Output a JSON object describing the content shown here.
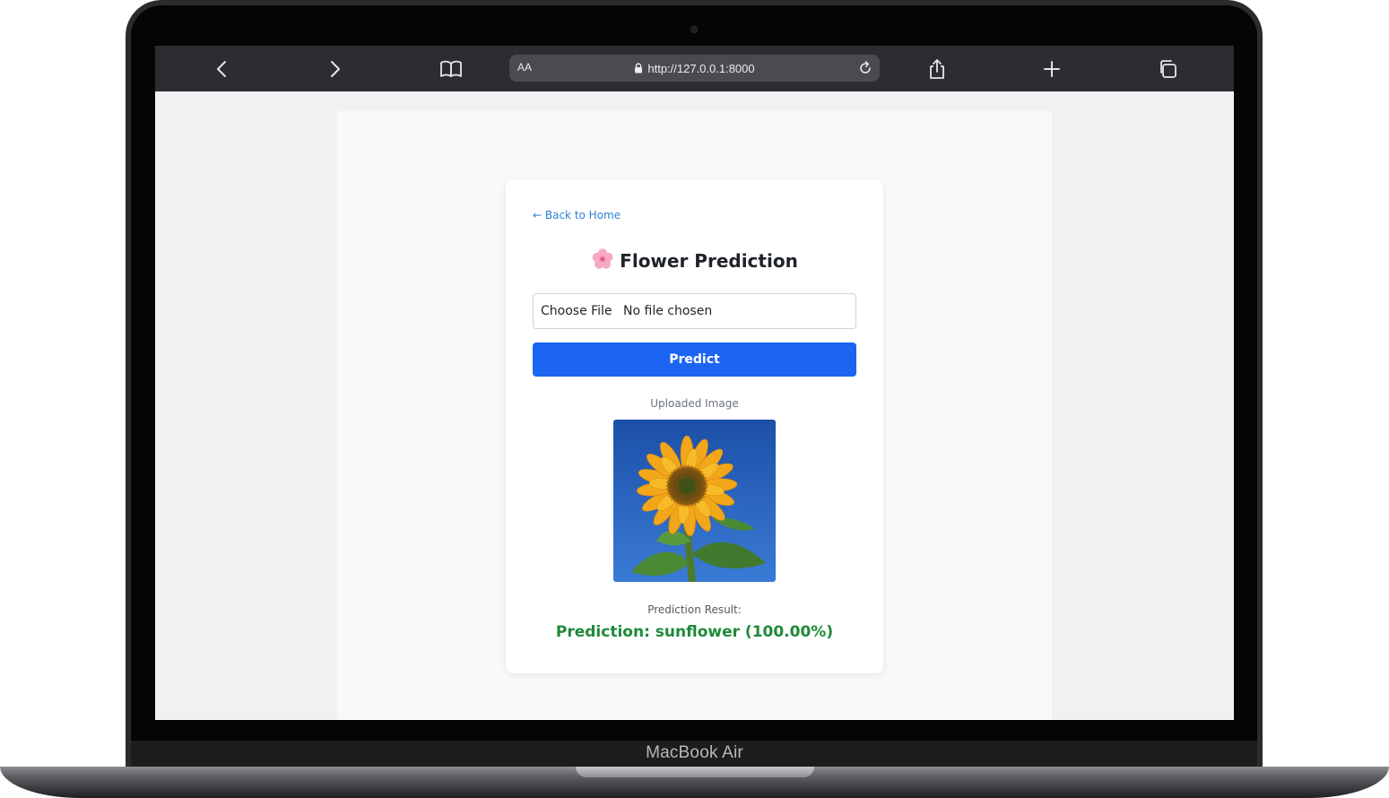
{
  "device": {
    "label": "MacBook Air"
  },
  "browser": {
    "url_text_size_label": "AA",
    "url": "http://127.0.0.1:8000",
    "icons": [
      "back-icon",
      "forward-icon",
      "bookmarks-icon",
      "lock-icon",
      "reload-icon",
      "share-icon",
      "new-tab-icon",
      "tabs-icon"
    ]
  },
  "page": {
    "back_link": "← Back to Home",
    "title_emoji": "🌸",
    "title": "Flower Prediction",
    "file_input": {
      "button_label": "Choose File",
      "status": "No file chosen"
    },
    "predict_button": "Predict",
    "uploaded_label": "Uploaded Image",
    "result_label": "Prediction Result:",
    "result_text": "Prediction: sunflower (100.00%)"
  },
  "colors": {
    "accent": "#1c64f2",
    "link": "#2f7ed8",
    "success": "#1e8a3a",
    "toolbar": "#2c2d30"
  }
}
